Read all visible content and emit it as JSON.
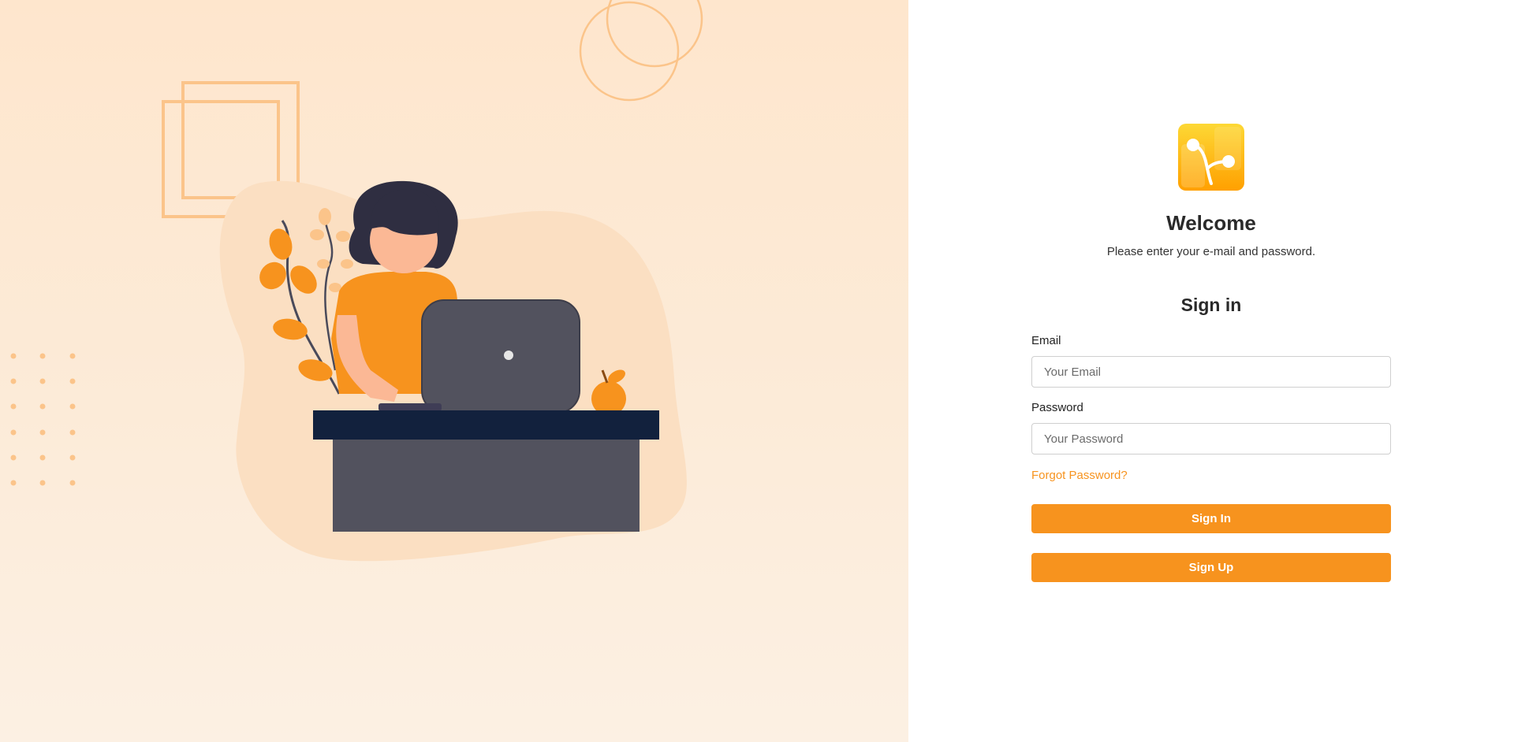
{
  "branding": {
    "logo_icon": "branch-logo-icon",
    "accent": "#f7931e",
    "logo_gradient": [
      "#fdd835",
      "#ffa000"
    ]
  },
  "welcome": {
    "title": "Welcome",
    "subtitle": "Please enter your e-mail and password."
  },
  "signin": {
    "heading": "Sign in",
    "email_label": "Email",
    "email_placeholder": "Your Email",
    "email_value": "",
    "password_label": "Password",
    "password_placeholder": "Your Password",
    "password_value": "",
    "forgot_label": "Forgot Password?",
    "signin_button": "Sign In",
    "signup_button": "Sign Up"
  },
  "illustration": {
    "icon": "woman-at-laptop-illustration"
  }
}
